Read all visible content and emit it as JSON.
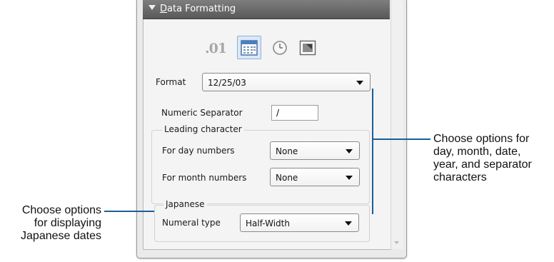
{
  "section": {
    "title": "Data Formatting"
  },
  "format_buttons": [
    {
      "icon": "number-format-icon",
      "text": ".01",
      "selected": false
    },
    {
      "icon": "calendar-icon",
      "selected": true
    },
    {
      "icon": "clock-icon",
      "selected": false
    },
    {
      "icon": "image-format-icon",
      "selected": false
    }
  ],
  "format": {
    "label": "Format",
    "value": "12/25/03"
  },
  "numeric_separator": {
    "label": "Numeric Separator",
    "value": "/"
  },
  "leading_character": {
    "title": "Leading character",
    "day": {
      "label": "For day numbers",
      "value": "None"
    },
    "month": {
      "label": "For month numbers",
      "value": "None"
    }
  },
  "japanese": {
    "title": "Japanese",
    "numeral_type": {
      "label": "Numeral type",
      "value": "Half-Width"
    }
  },
  "callouts": {
    "right": [
      "Choose options for",
      "day, month, date,",
      "year, and separator",
      "characters"
    ],
    "left": [
      "Choose options",
      "for displaying",
      "Japanese dates"
    ]
  },
  "colors": {
    "leader_line": "#1b5e9a",
    "header": "#6b6b6b",
    "selected_button": "#dce8f6"
  }
}
